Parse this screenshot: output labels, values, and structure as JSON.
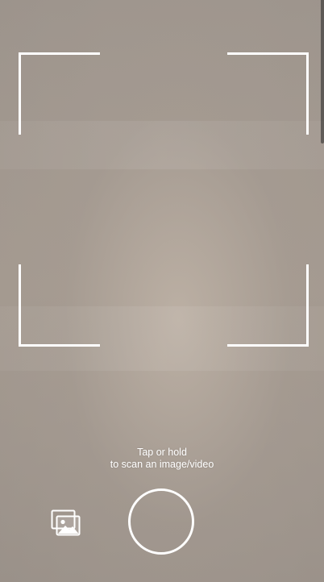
{
  "scanner": {
    "hint_line1": "Tap or hold",
    "hint_line2": "to scan an image/video"
  },
  "icons": {
    "gallery": "gallery-icon",
    "shutter": "shutter-button"
  },
  "colors": {
    "overlay": "#ffffff",
    "background": "#a9a097"
  }
}
